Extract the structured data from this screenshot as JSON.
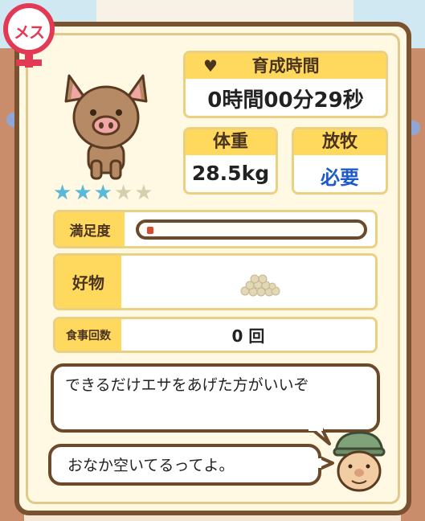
{
  "gender": {
    "label": "メス",
    "color": "#e23a55"
  },
  "rating": {
    "stars_filled": 3,
    "stars_total": 5
  },
  "growth_time": {
    "title": "育成時間",
    "value": "0時間00分29秒"
  },
  "weight": {
    "title": "体重",
    "value": "28.5kg"
  },
  "grazing": {
    "title": "放牧",
    "value": "必要"
  },
  "satisfaction": {
    "label": "満足度",
    "level": 0.03
  },
  "favorite": {
    "label": "好物",
    "icon": "grain-pile-icon"
  },
  "meals": {
    "label": "食事回数",
    "value": "0 回"
  },
  "dialogue": {
    "line1": "できるだけエサをあげた方がいいぞ",
    "line2": "おなか空いてるってよ。"
  },
  "colors": {
    "accent": "#ffd95e",
    "frame": "#7a5230",
    "star_on": "#5ab8d8"
  }
}
